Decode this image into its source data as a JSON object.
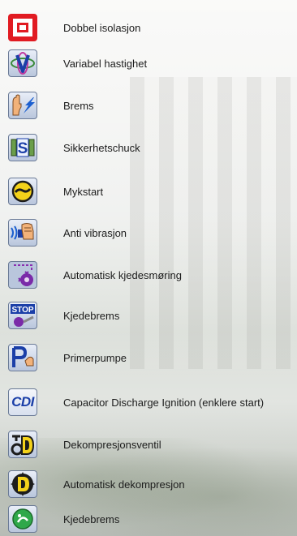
{
  "features": [
    {
      "label": "Dobbel isolasjon",
      "icon": "double-insulation-icon"
    },
    {
      "label": "Variabel hastighet",
      "icon": "variable-speed-icon"
    },
    {
      "label": "Brems",
      "icon": "brake-icon"
    },
    {
      "label": "Sikkerhetschuck",
      "icon": "safety-chuck-icon"
    },
    {
      "label": "Mykstart",
      "icon": "soft-start-icon"
    },
    {
      "label": "Anti vibrasjon",
      "icon": "anti-vibration-icon"
    },
    {
      "label": "Automatisk kjedesmøring",
      "icon": "auto-chain-lubrication-icon"
    },
    {
      "label": "Kjedebrems",
      "icon": "chain-brake-stop-icon"
    },
    {
      "label": "Primerpumpe",
      "icon": "primer-pump-icon"
    },
    {
      "label": "Capacitor Discharge Ignition (enklere start)",
      "icon": "cdi-icon",
      "icon_text": "CDI"
    },
    {
      "label": "Dekompresjonsventil",
      "icon": "decompression-valve-icon"
    },
    {
      "label": "Automatisk dekompresjon",
      "icon": "auto-decompression-icon"
    },
    {
      "label": "Kjedebrems",
      "icon": "chain-brake-icon"
    }
  ]
}
